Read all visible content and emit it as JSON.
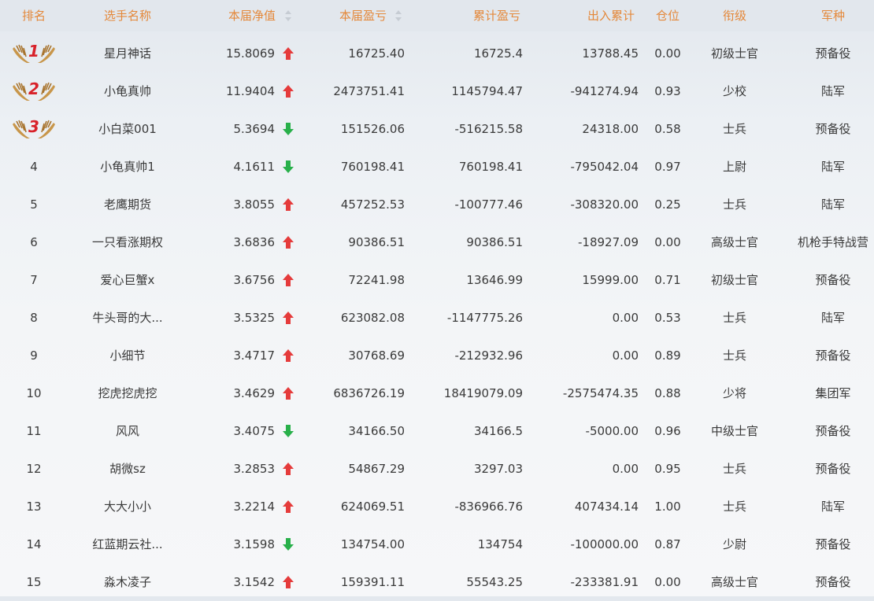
{
  "header": {
    "rank": "排名",
    "player": "选手名称",
    "net_value": "本届净值",
    "profit": "本届盈亏",
    "cumulative_profit": "累计盈亏",
    "inout_total": "出入累计",
    "position": "仓位",
    "rank_title": "衔级",
    "branch": "军种"
  },
  "colors": {
    "header_text": "#e4883a",
    "up_arrow": "#e53b3b",
    "down_arrow": "#28b04a",
    "medal_gold": "#c8964a",
    "medal_number": "#d8222a"
  },
  "rows": [
    {
      "rank": "1",
      "name": "星月神话",
      "net": "15.8069",
      "trend": "up",
      "profit": "16725.40",
      "cum": "16725.4",
      "inout": "13788.45",
      "pos": "0.00",
      "title": "初级士官",
      "branch": "预备役"
    },
    {
      "rank": "2",
      "name": "小龟真帅",
      "net": "11.9404",
      "trend": "up",
      "profit": "2473751.41",
      "cum": "1145794.47",
      "inout": "-941274.94",
      "pos": "0.93",
      "title": "少校",
      "branch": "陆军"
    },
    {
      "rank": "3",
      "name": "小白菜001",
      "net": "5.3694",
      "trend": "down",
      "profit": "151526.06",
      "cum": "-516215.58",
      "inout": "24318.00",
      "pos": "0.58",
      "title": "士兵",
      "branch": "预备役"
    },
    {
      "rank": "4",
      "name": "小龟真帅1",
      "net": "4.1611",
      "trend": "down",
      "profit": "760198.41",
      "cum": "760198.41",
      "inout": "-795042.04",
      "pos": "0.97",
      "title": "上尉",
      "branch": "陆军"
    },
    {
      "rank": "5",
      "name": "老鹰期货",
      "net": "3.8055",
      "trend": "up",
      "profit": "457252.53",
      "cum": "-100777.46",
      "inout": "-308320.00",
      "pos": "0.25",
      "title": "士兵",
      "branch": "陆军"
    },
    {
      "rank": "6",
      "name": "一只看涨期权",
      "net": "3.6836",
      "trend": "up",
      "profit": "90386.51",
      "cum": "90386.51",
      "inout": "-18927.09",
      "pos": "0.00",
      "title": "高级士官",
      "branch": "机枪手特战营"
    },
    {
      "rank": "7",
      "name": "爱心巨蟹x",
      "net": "3.6756",
      "trend": "up",
      "profit": "72241.98",
      "cum": "13646.99",
      "inout": "15999.00",
      "pos": "0.71",
      "title": "初级士官",
      "branch": "预备役"
    },
    {
      "rank": "8",
      "name": "牛头哥的大...",
      "net": "3.5325",
      "trend": "up",
      "profit": "623082.08",
      "cum": "-1147775.26",
      "inout": "0.00",
      "pos": "0.53",
      "title": "士兵",
      "branch": "陆军"
    },
    {
      "rank": "9",
      "name": "小细节",
      "net": "3.4717",
      "trend": "up",
      "profit": "30768.69",
      "cum": "-212932.96",
      "inout": "0.00",
      "pos": "0.89",
      "title": "士兵",
      "branch": "预备役"
    },
    {
      "rank": "10",
      "name": "挖虎挖虎挖",
      "net": "3.4629",
      "trend": "up",
      "profit": "6836726.19",
      "cum": "18419079.09",
      "inout": "-2575474.35",
      "pos": "0.88",
      "title": "少将",
      "branch": "集团军"
    },
    {
      "rank": "11",
      "name": "风风",
      "net": "3.4075",
      "trend": "down",
      "profit": "34166.50",
      "cum": "34166.5",
      "inout": "-5000.00",
      "pos": "0.96",
      "title": "中级士官",
      "branch": "预备役"
    },
    {
      "rank": "12",
      "name": "胡微sz",
      "net": "3.2853",
      "trend": "up",
      "profit": "54867.29",
      "cum": "3297.03",
      "inout": "0.00",
      "pos": "0.95",
      "title": "士兵",
      "branch": "预备役"
    },
    {
      "rank": "13",
      "name": "大大小小",
      "net": "3.2214",
      "trend": "up",
      "profit": "624069.51",
      "cum": "-836966.76",
      "inout": "407434.14",
      "pos": "1.00",
      "title": "士兵",
      "branch": "陆军"
    },
    {
      "rank": "14",
      "name": "红蓝期云社...",
      "net": "3.1598",
      "trend": "down",
      "profit": "134754.00",
      "cum": "134754",
      "inout": "-100000.00",
      "pos": "0.87",
      "title": "少尉",
      "branch": "预备役"
    },
    {
      "rank": "15",
      "name": "淼木凌子",
      "net": "3.1542",
      "trend": "up",
      "profit": "159391.11",
      "cum": "55543.25",
      "inout": "-233381.91",
      "pos": "0.00",
      "title": "高级士官",
      "branch": "预备役"
    }
  ]
}
